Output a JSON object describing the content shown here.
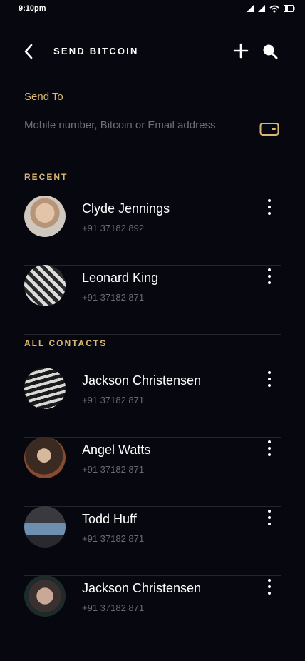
{
  "status_bar": {
    "time": "9:10pm"
  },
  "header": {
    "title": "SEND BITCOIN"
  },
  "send_to": {
    "label": "Send To",
    "placeholder": "Mobile number, Bitcoin or Email address"
  },
  "recent": {
    "label": "RECENT",
    "contacts": [
      {
        "name": "Clyde Jennings",
        "phone": "+91 37182 892"
      },
      {
        "name": "Leonard King",
        "phone": "+91 37182 871"
      }
    ]
  },
  "all_contacts": {
    "label": "ALL CONTACTS",
    "contacts": [
      {
        "name": "Jackson Christensen",
        "phone": "+91 37182 871"
      },
      {
        "name": "Angel Watts",
        "phone": "+91 37182 871"
      },
      {
        "name": "Todd Huff",
        "phone": "+91 37182 871"
      },
      {
        "name": "Jackson Christensen",
        "phone": "+91 37182 871"
      }
    ]
  },
  "colors": {
    "background": "#07070f",
    "accent": "#d9b871",
    "divider": "#24242e",
    "muted": "#6a6a74"
  },
  "icons": [
    "back-icon",
    "add-icon",
    "search-icon",
    "wallet-icon",
    "more-vertical-icon",
    "signal-icon",
    "wifi-icon",
    "battery-icon"
  ]
}
